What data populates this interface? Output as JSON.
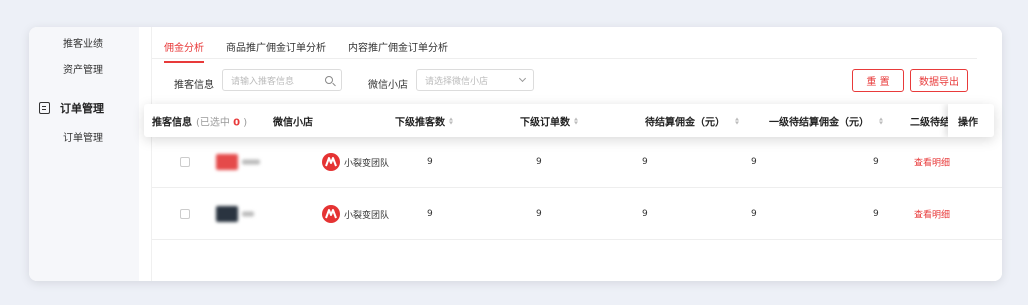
{
  "sidebar": {
    "items": [
      "推客业绩",
      "资产管理"
    ],
    "group": {
      "label": "订单管理",
      "icon": "document-icon"
    },
    "sub_items": [
      "订单管理"
    ]
  },
  "tabs": [
    "佣金分析",
    "商品推广佣金订单分析",
    "内容推广佣金订单分析"
  ],
  "filters": {
    "promoter_label": "推客信息",
    "promoter_placeholder": "请输入推客信息",
    "shop_label": "微信小店",
    "shop_placeholder": "请选择微信小店"
  },
  "buttons": {
    "reset": "重 置",
    "export": "数据导出"
  },
  "table": {
    "headers": {
      "promoter": "推客信息",
      "selected_prefix": "(已选中",
      "selected_count": "0",
      "selected_suffix": ")",
      "shop": "微信小店",
      "sub_promoters": "下级推客数",
      "sub_orders": "下级订单数",
      "pending_commission": "待结算佣金（元）",
      "level1_pending": "一级待结算佣金（元）",
      "level2_pending": "二级待结",
      "actions": "操作"
    },
    "rows": [
      {
        "shop": "小裂变团队",
        "sub_promoters": "9",
        "sub_orders": "9",
        "pending": "9",
        "level1": "9",
        "level2": "9",
        "action": "查看明细"
      },
      {
        "shop": "小裂变团队",
        "sub_promoters": "9",
        "sub_orders": "9",
        "pending": "9",
        "level1": "9",
        "level2": "9",
        "action": "查看明细"
      }
    ]
  },
  "colors": {
    "accent": "#e83a3a",
    "shop_logo": "#e53333"
  }
}
